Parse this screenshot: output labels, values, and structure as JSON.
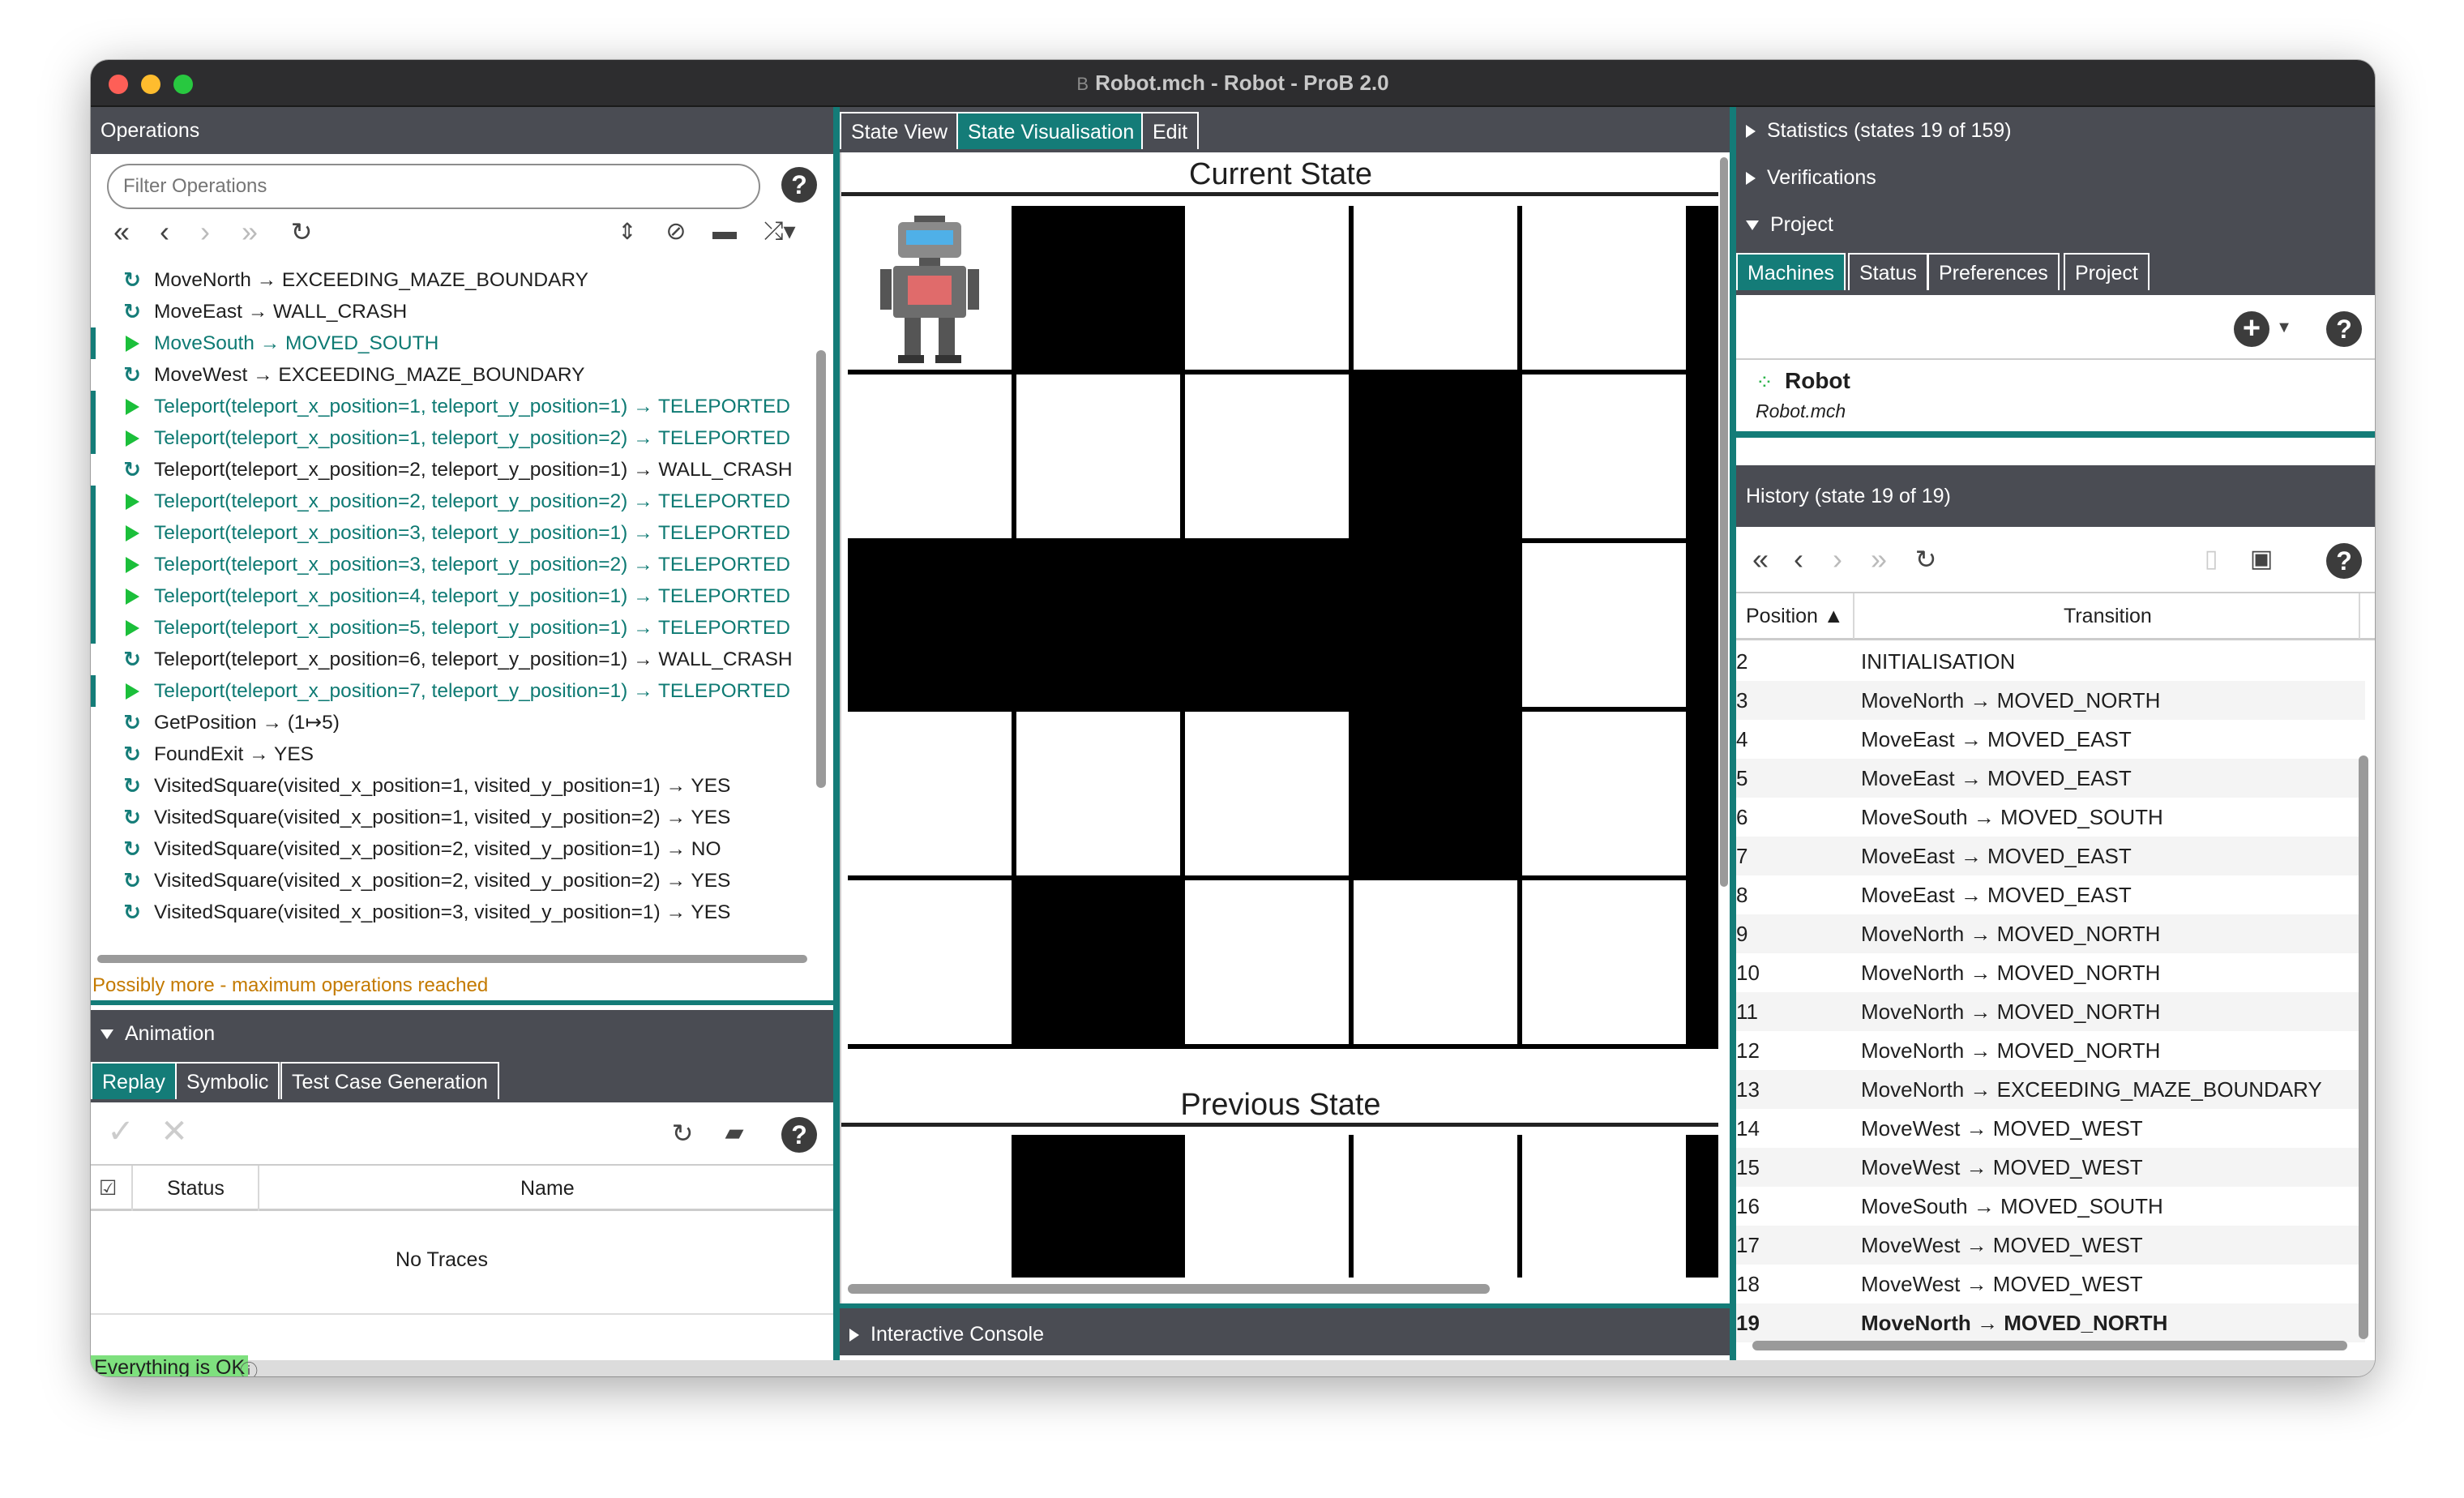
{
  "window": {
    "title": "Robot.mch - Robot - ProB 2.0",
    "logo": "B"
  },
  "operations": {
    "header": "Operations",
    "filter_placeholder": "Filter Operations",
    "items": [
      {
        "icon": "refresh-icon",
        "text": "MoveNorth → EXCEEDING_MAZE_BOUNDARY",
        "enabled": false
      },
      {
        "icon": "refresh-icon",
        "text": "MoveEast → WALL_CRASH",
        "enabled": false
      },
      {
        "icon": "play-icon",
        "text": "MoveSouth → MOVED_SOUTH",
        "enabled": true
      },
      {
        "icon": "refresh-icon",
        "text": "MoveWest → EXCEEDING_MAZE_BOUNDARY",
        "enabled": false
      },
      {
        "icon": "play-icon",
        "text": "Teleport(teleport_x_position=1, teleport_y_position=1) → TELEPORTED",
        "enabled": true
      },
      {
        "icon": "play-icon",
        "text": "Teleport(teleport_x_position=1, teleport_y_position=2) → TELEPORTED",
        "enabled": true
      },
      {
        "icon": "refresh-icon",
        "text": "Teleport(teleport_x_position=2, teleport_y_position=1) → WALL_CRASH",
        "enabled": false
      },
      {
        "icon": "play-icon",
        "text": "Teleport(teleport_x_position=2, teleport_y_position=2) → TELEPORTED",
        "enabled": true
      },
      {
        "icon": "play-icon",
        "text": "Teleport(teleport_x_position=3, teleport_y_position=1) → TELEPORTED",
        "enabled": true
      },
      {
        "icon": "play-icon",
        "text": "Teleport(teleport_x_position=3, teleport_y_position=2) → TELEPORTED",
        "enabled": true
      },
      {
        "icon": "play-icon",
        "text": "Teleport(teleport_x_position=4, teleport_y_position=1) → TELEPORTED",
        "enabled": true
      },
      {
        "icon": "play-icon",
        "text": "Teleport(teleport_x_position=5, teleport_y_position=1) → TELEPORTED",
        "enabled": true
      },
      {
        "icon": "refresh-icon",
        "text": "Teleport(teleport_x_position=6, teleport_y_position=1) → WALL_CRASH",
        "enabled": false
      },
      {
        "icon": "play-icon",
        "text": "Teleport(teleport_x_position=7, teleport_y_position=1) → TELEPORTED",
        "enabled": true
      },
      {
        "icon": "refresh-icon",
        "text": "GetPosition → (1↦5)",
        "enabled": false
      },
      {
        "icon": "refresh-icon",
        "text": "FoundExit → YES",
        "enabled": false
      },
      {
        "icon": "refresh-icon",
        "text": "VisitedSquare(visited_x_position=1, visited_y_position=1) → YES",
        "enabled": false
      },
      {
        "icon": "refresh-icon",
        "text": "VisitedSquare(visited_x_position=1, visited_y_position=2) → YES",
        "enabled": false
      },
      {
        "icon": "refresh-icon",
        "text": "VisitedSquare(visited_x_position=2, visited_y_position=1) → NO",
        "enabled": false
      },
      {
        "icon": "refresh-icon",
        "text": "VisitedSquare(visited_x_position=2, visited_y_position=2) → YES",
        "enabled": false
      },
      {
        "icon": "refresh-icon",
        "text": "VisitedSquare(visited_x_position=3, visited_y_position=1) → YES",
        "enabled": false
      }
    ],
    "warning": "Possibly more - maximum operations reached"
  },
  "animation": {
    "header": "Animation",
    "tabs": [
      "Replay",
      "Symbolic",
      "Test Case Generation"
    ],
    "selected_tab": 0,
    "columns": {
      "status": "Status",
      "name": "Name"
    },
    "empty": "No Traces"
  },
  "status_bar": {
    "text": "Everything is OK"
  },
  "center": {
    "tabs": [
      "State View",
      "State Visualisation",
      "Edit"
    ],
    "selected_tab": 1,
    "current_title": "Current State",
    "previous_title": "Previous State",
    "current_grid": [
      [
        0,
        1,
        0,
        0,
        0
      ],
      [
        0,
        0,
        0,
        1,
        0
      ],
      [
        1,
        1,
        1,
        1,
        0
      ],
      [
        0,
        0,
        0,
        1,
        0
      ],
      [
        0,
        1,
        0,
        0,
        0
      ]
    ],
    "previous_grid_top": [
      0,
      1,
      0,
      0,
      0
    ],
    "robot_cell": [
      0,
      0
    ],
    "console": "Interactive Console"
  },
  "right": {
    "statistics": "Statistics (states 19 of 159)",
    "verifications": "Verifications",
    "project": "Project",
    "project_tabs": [
      "Machines",
      "Status",
      "Preferences",
      "Project"
    ],
    "selected_project_tab": 0,
    "machine_name": "Robot",
    "machine_file": "Robot.mch",
    "history_header": "History (state 19 of 19)",
    "history_columns": {
      "position": "Position ▲",
      "transition": "Transition"
    },
    "history": [
      {
        "pos": "2",
        "transition": "INITIALISATION"
      },
      {
        "pos": "3",
        "transition": "MoveNorth → MOVED_NORTH"
      },
      {
        "pos": "4",
        "transition": "MoveEast → MOVED_EAST"
      },
      {
        "pos": "5",
        "transition": "MoveEast → MOVED_EAST"
      },
      {
        "pos": "6",
        "transition": "MoveSouth → MOVED_SOUTH"
      },
      {
        "pos": "7",
        "transition": "MoveEast → MOVED_EAST"
      },
      {
        "pos": "8",
        "transition": "MoveEast → MOVED_EAST"
      },
      {
        "pos": "9",
        "transition": "MoveNorth → MOVED_NORTH"
      },
      {
        "pos": "10",
        "transition": "MoveNorth → MOVED_NORTH"
      },
      {
        "pos": "11",
        "transition": "MoveNorth → MOVED_NORTH"
      },
      {
        "pos": "12",
        "transition": "MoveNorth → MOVED_NORTH"
      },
      {
        "pos": "13",
        "transition": "MoveNorth → EXCEEDING_MAZE_BOUNDARY"
      },
      {
        "pos": "14",
        "transition": "MoveWest → MOVED_WEST"
      },
      {
        "pos": "15",
        "transition": "MoveWest → MOVED_WEST"
      },
      {
        "pos": "16",
        "transition": "MoveSouth → MOVED_SOUTH"
      },
      {
        "pos": "17",
        "transition": "MoveWest → MOVED_WEST"
      },
      {
        "pos": "18",
        "transition": "MoveWest → MOVED_WEST"
      },
      {
        "pos": "19",
        "transition": "MoveNorth → MOVED_NORTH"
      }
    ]
  },
  "colors": {
    "accent": "#147c78",
    "panel": "#4a4c53",
    "enabled_play": "#1bbf3a",
    "warning": "#c47a00",
    "ok": "#7ee07e"
  }
}
